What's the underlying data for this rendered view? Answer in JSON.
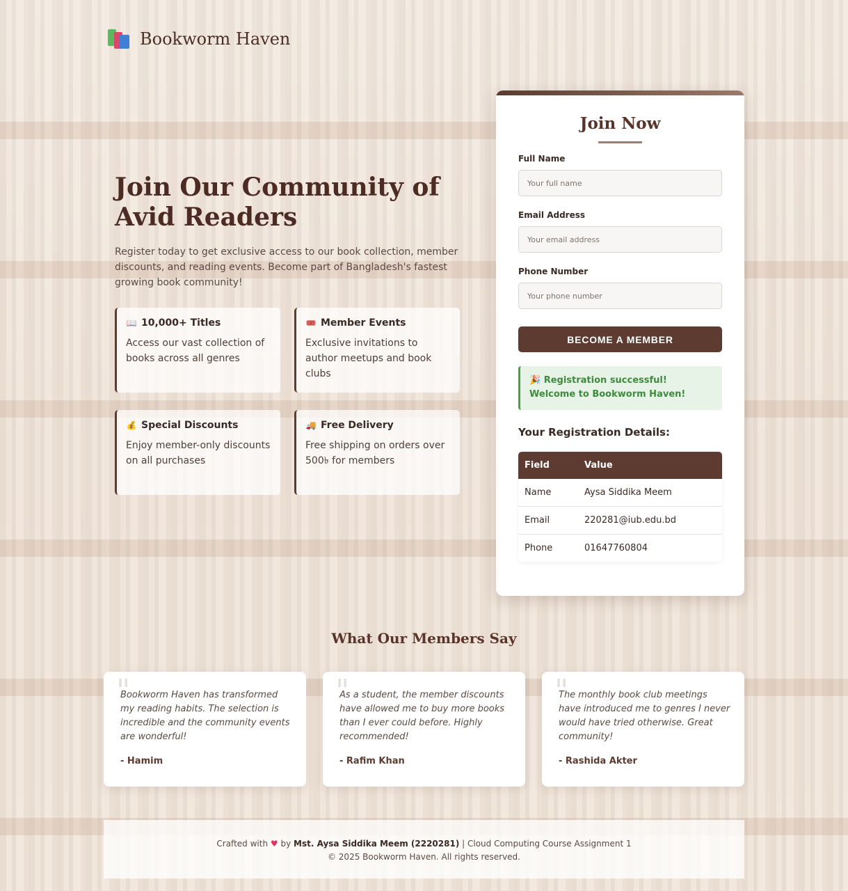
{
  "brand": {
    "name": "Bookworm Haven",
    "icon": "books-icon"
  },
  "hero": {
    "title": "Join Our Community of Avid Readers",
    "subtitle": "Register today to get exclusive access to our book collection, member discounts, and reading events. Become part of Bangladesh's fastest growing book community!"
  },
  "features": [
    {
      "icon": "open-book-icon",
      "title": "10,000+ Titles",
      "desc": "Access our vast collection of books across all genres"
    },
    {
      "icon": "ticket-icon",
      "title": "Member Events",
      "desc": "Exclusive invitations to author meetups and book clubs"
    },
    {
      "icon": "money-bag-icon",
      "title": "Special Discounts",
      "desc": "Enjoy member-only discounts on all purchases"
    },
    {
      "icon": "delivery-truck-icon",
      "title": "Free Delivery",
      "desc": "Free shipping on orders over 500৳ for members"
    }
  ],
  "form": {
    "title": "Join Now",
    "fields": [
      {
        "label": "Full Name",
        "placeholder": "Your full name"
      },
      {
        "label": "Email Address",
        "placeholder": "Your email address"
      },
      {
        "label": "Phone Number",
        "placeholder": "Your phone number"
      }
    ],
    "submit_label": "BECOME A MEMBER",
    "success_message": "🎉 Registration successful! Welcome to Bookworm Haven!"
  },
  "registration": {
    "heading": "Your Registration Details:",
    "columns": [
      "Field",
      "Value"
    ],
    "rows": [
      [
        "Name",
        "Aysa Siddika Meem"
      ],
      [
        "Email",
        "220281@iub.edu.bd"
      ],
      [
        "Phone",
        "01647760804"
      ]
    ]
  },
  "testimonials": {
    "title": "What Our Members Say",
    "items": [
      {
        "text": "Bookworm Haven has transformed my reading habits. The selection is incredible and the community events are wonderful!",
        "author": "- Hamim"
      },
      {
        "text": "As a student, the member discounts have allowed me to buy more books than I ever could before. Highly recommended!",
        "author": "- Rafim Khan"
      },
      {
        "text": "The monthly book club meetings have introduced me to genres I never would have tried otherwise. Great community!",
        "author": "- Rashida Akter"
      }
    ]
  },
  "footer": {
    "crafted": "Crafted with",
    "by": "by",
    "author": "Mst. Aysa Siddika Meem (2220281)",
    "course": "| Cloud Computing Course Assignment 1",
    "copyright": "© 2025 Bookworm Haven. All rights reserved."
  },
  "colors": {
    "primary": "#5d3b31",
    "success": "#3f8a3f",
    "heart": "#e0325f"
  }
}
